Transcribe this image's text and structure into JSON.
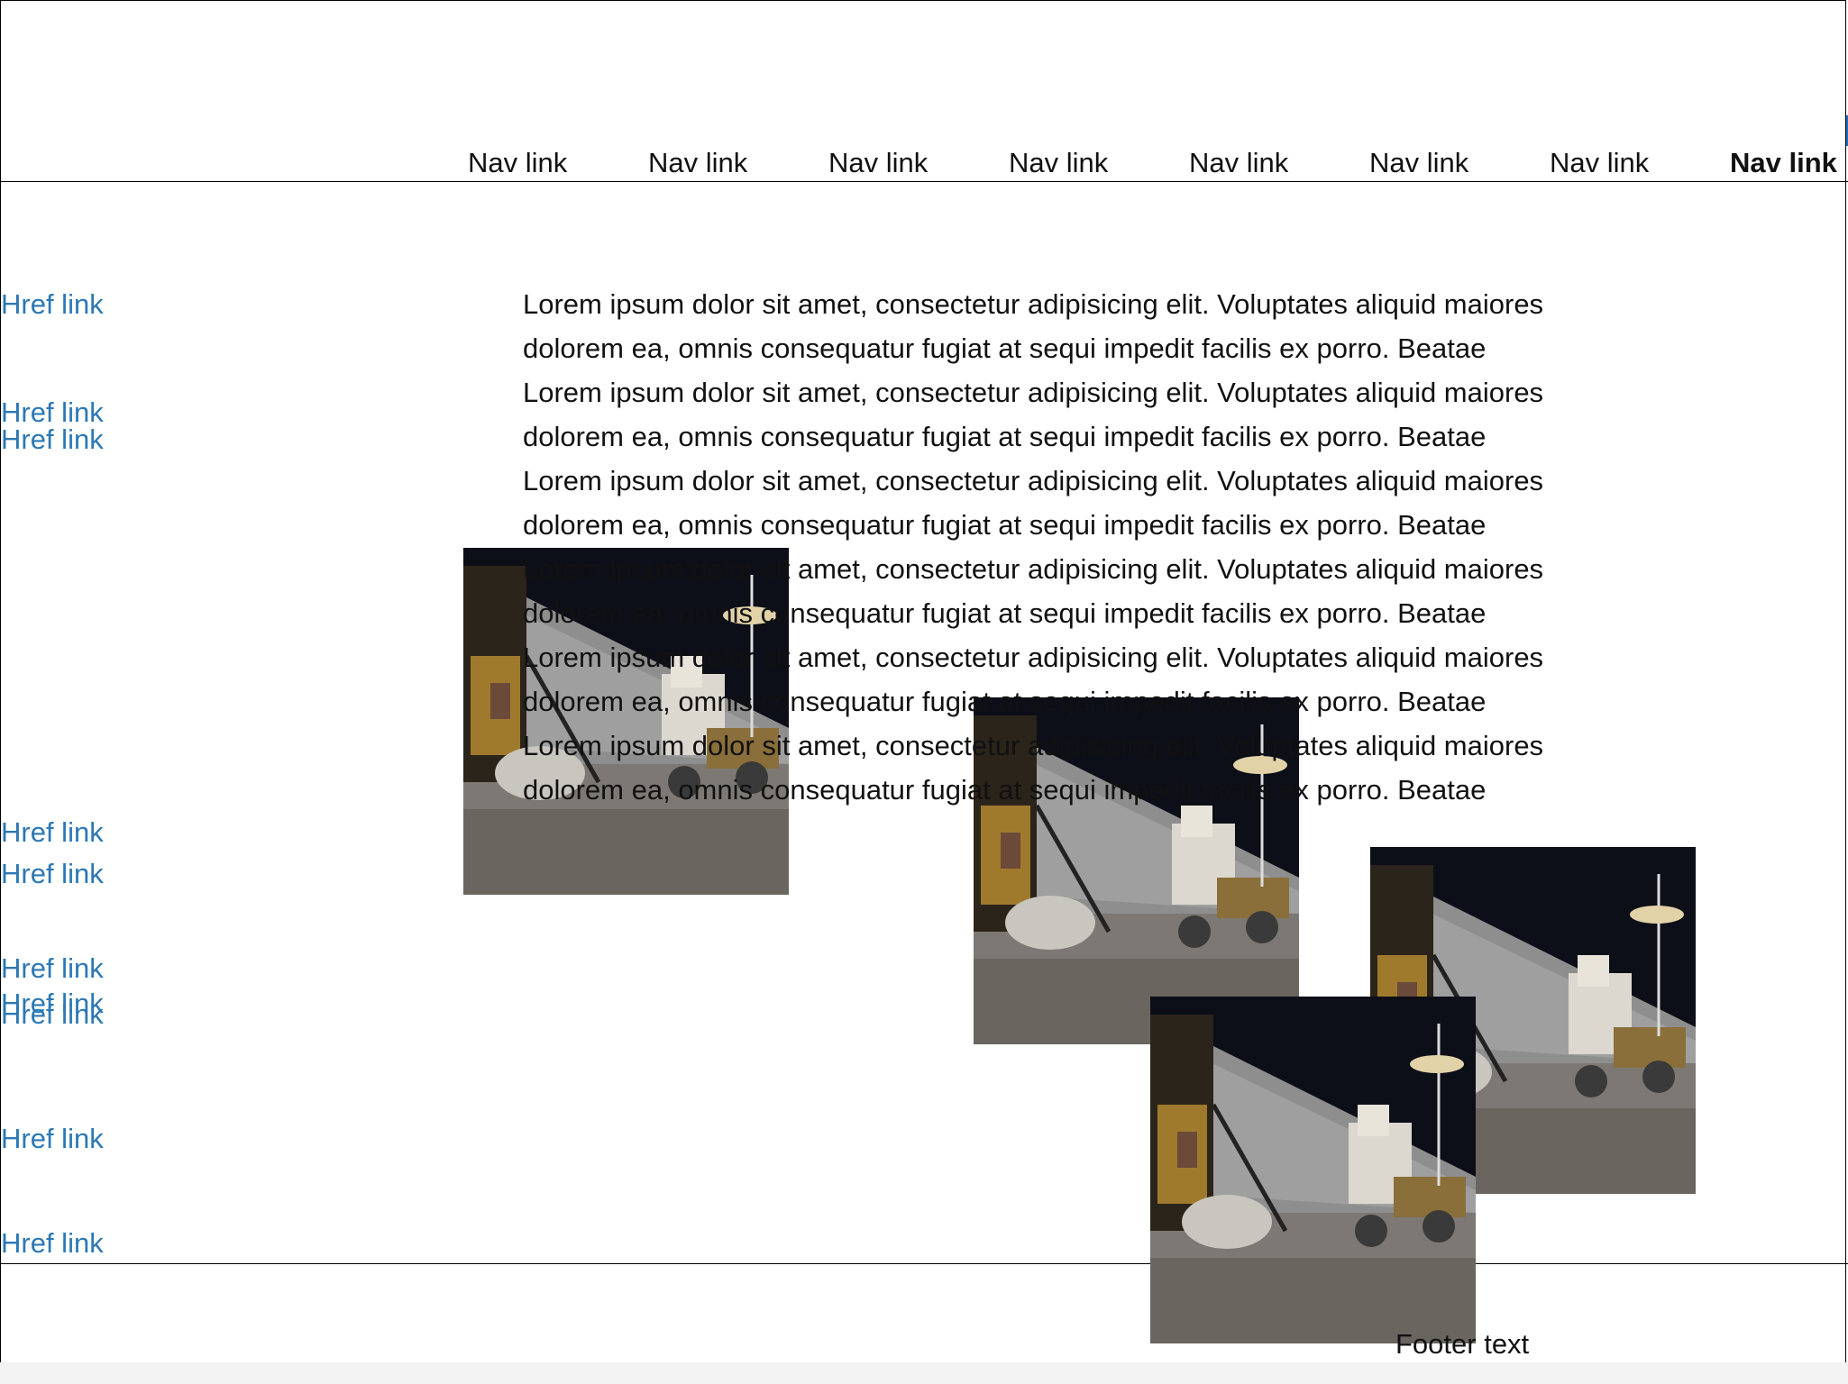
{
  "header": {
    "nav_links": [
      {
        "label": "Nav link",
        "active": false
      },
      {
        "label": "Nav link",
        "active": false
      },
      {
        "label": "Nav link",
        "active": false
      },
      {
        "label": "Nav link",
        "active": false
      },
      {
        "label": "Nav link",
        "active": false
      },
      {
        "label": "Nav link",
        "active": false
      },
      {
        "label": "Nav link",
        "active": false
      },
      {
        "label": "Nav link",
        "active": true
      }
    ]
  },
  "sidebar": {
    "links": [
      {
        "label": "Href link"
      },
      {
        "label": "Href link"
      },
      {
        "label": "Href link"
      },
      {
        "label": "Href link"
      },
      {
        "label": "Href link"
      },
      {
        "label": "Href link"
      },
      {
        "label": "Href link"
      },
      {
        "label": "Href link"
      },
      {
        "label": "Href link"
      },
      {
        "label": "Href link"
      }
    ]
  },
  "main": {
    "paragraph_lines": [
      "Lorem ipsum dolor sit amet, consectetur adipisicing elit. Voluptates aliquid maiores",
      "dolorem ea, omnis consequatur fugiat at sequi impedit facilis ex porro. Beatae",
      "Lorem ipsum dolor sit amet, consectetur adipisicing elit. Voluptates aliquid maiores",
      "dolorem ea, omnis consequatur fugiat at sequi impedit facilis ex porro. Beatae",
      "Lorem ipsum dolor sit amet, consectetur adipisicing elit. Voluptates aliquid maiores",
      "dolorem ea, omnis consequatur fugiat at sequi impedit facilis ex porro. Beatae",
      "Lorem ipsum dolor sit amet, consectetur adipisicing elit. Voluptates aliquid maiores",
      "dolorem ea, omnis consequatur fugiat at sequi impedit facilis ex porro. Beatae",
      "Lorem ipsum dolor sit amet, consectetur adipisicing elit. Voluptates aliquid maiores",
      "dolorem ea, omnis consequatur fugiat at sequi impedit facilis ex porro. Beatae",
      "Lorem ipsum dolor sit amet, consectetur adipisicing elit. Voluptates aliquid maiores",
      "dolorem ea, omnis consequatur fugiat at sequi impedit facilis ex porro. Beatae"
    ],
    "images": [
      {
        "subject": "lunar-rover-photo"
      },
      {
        "subject": "lunar-rover-photo"
      },
      {
        "subject": "lunar-rover-photo"
      },
      {
        "subject": "lunar-rover-photo"
      }
    ]
  },
  "footer": {
    "text": "Footer text"
  },
  "colors": {
    "link": "#2b78b5",
    "text": "#111111",
    "border": "#000000"
  }
}
